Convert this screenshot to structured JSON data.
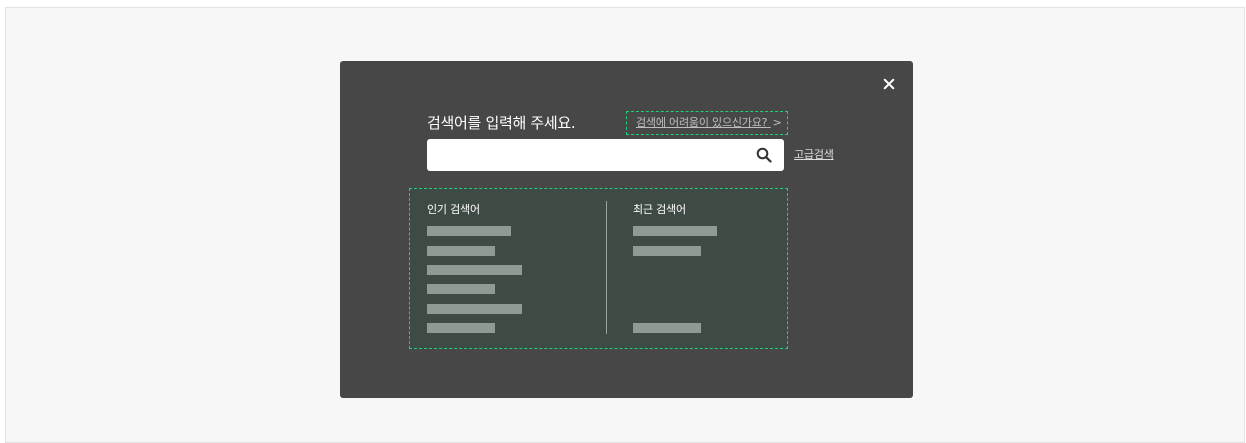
{
  "modal": {
    "close_label": "×",
    "title": "검색어를 입력해 주세요.",
    "help_link": "검색에 어려움이 있으신가요?",
    "help_chevron": ">",
    "search": {
      "value": "",
      "placeholder": ""
    },
    "advanced_search": "고급검색",
    "popular": {
      "title": "인기 검색어",
      "items": [
        "",
        "",
        "",
        "",
        "",
        ""
      ]
    },
    "recent": {
      "title": "최근 검색어",
      "items": [
        "",
        "",
        ""
      ]
    }
  },
  "icons": {
    "close": "close-icon",
    "search": "search-icon"
  },
  "colors": {
    "page_bg": "#f7f7f7",
    "modal_bg": "#474747",
    "panel_bg": "#3e4b45",
    "highlight_border": "#1ecf7e",
    "placeholder_bar": "#8f9a95"
  }
}
